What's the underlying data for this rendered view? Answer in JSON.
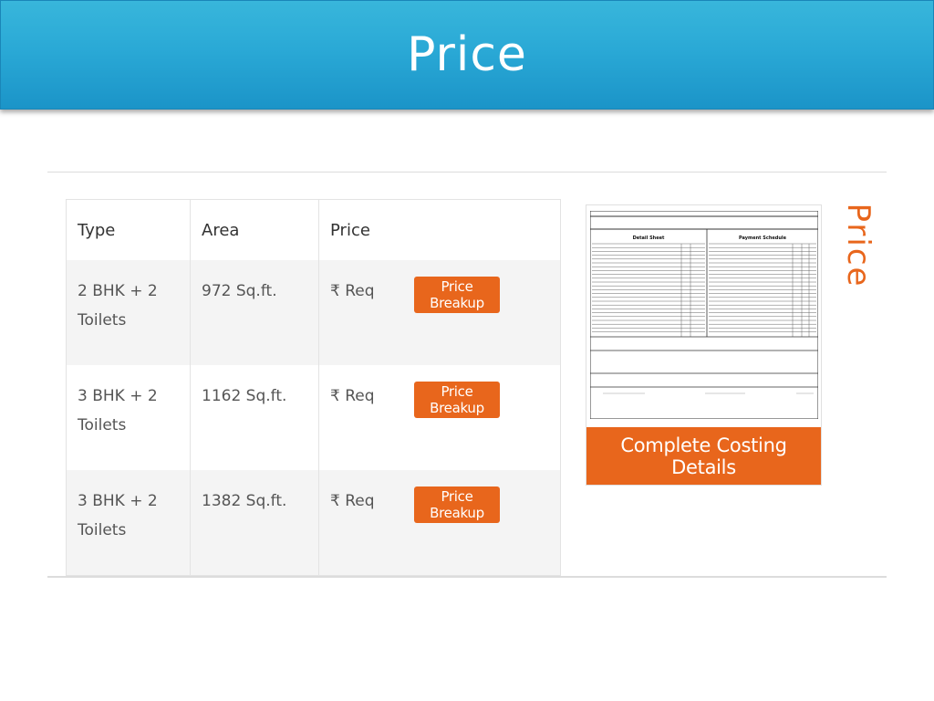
{
  "slide": {
    "title": "Price"
  },
  "table": {
    "headers": [
      "Type",
      "Area",
      "Price"
    ],
    "rows": [
      {
        "type_line1": "2 BHK + 2",
        "type_line2": "Toilets",
        "area": "972 Sq.ft.",
        "price": "₹ Req",
        "button": "Price Breakup"
      },
      {
        "type_line1": "3 BHK + 2",
        "type_line2": "Toilets",
        "area": "1162 Sq.ft.",
        "price": "₹ Req",
        "button": "Price Breakup"
      },
      {
        "type_line1": "3 BHK + 2",
        "type_line2": "Toilets",
        "area": "1382 Sq.ft.",
        "price": "₹ Req",
        "button": "Price Breakup"
      }
    ]
  },
  "costing": {
    "button": "Complete Costing Details",
    "sheet_left_title": "Detail Sheet",
    "sheet_right_title": "Payment Schedule"
  },
  "side_label": "Price",
  "colors": {
    "banner": "#2aa9d6",
    "accent": "#e8661c",
    "row_alt": "#f4f4f4"
  }
}
